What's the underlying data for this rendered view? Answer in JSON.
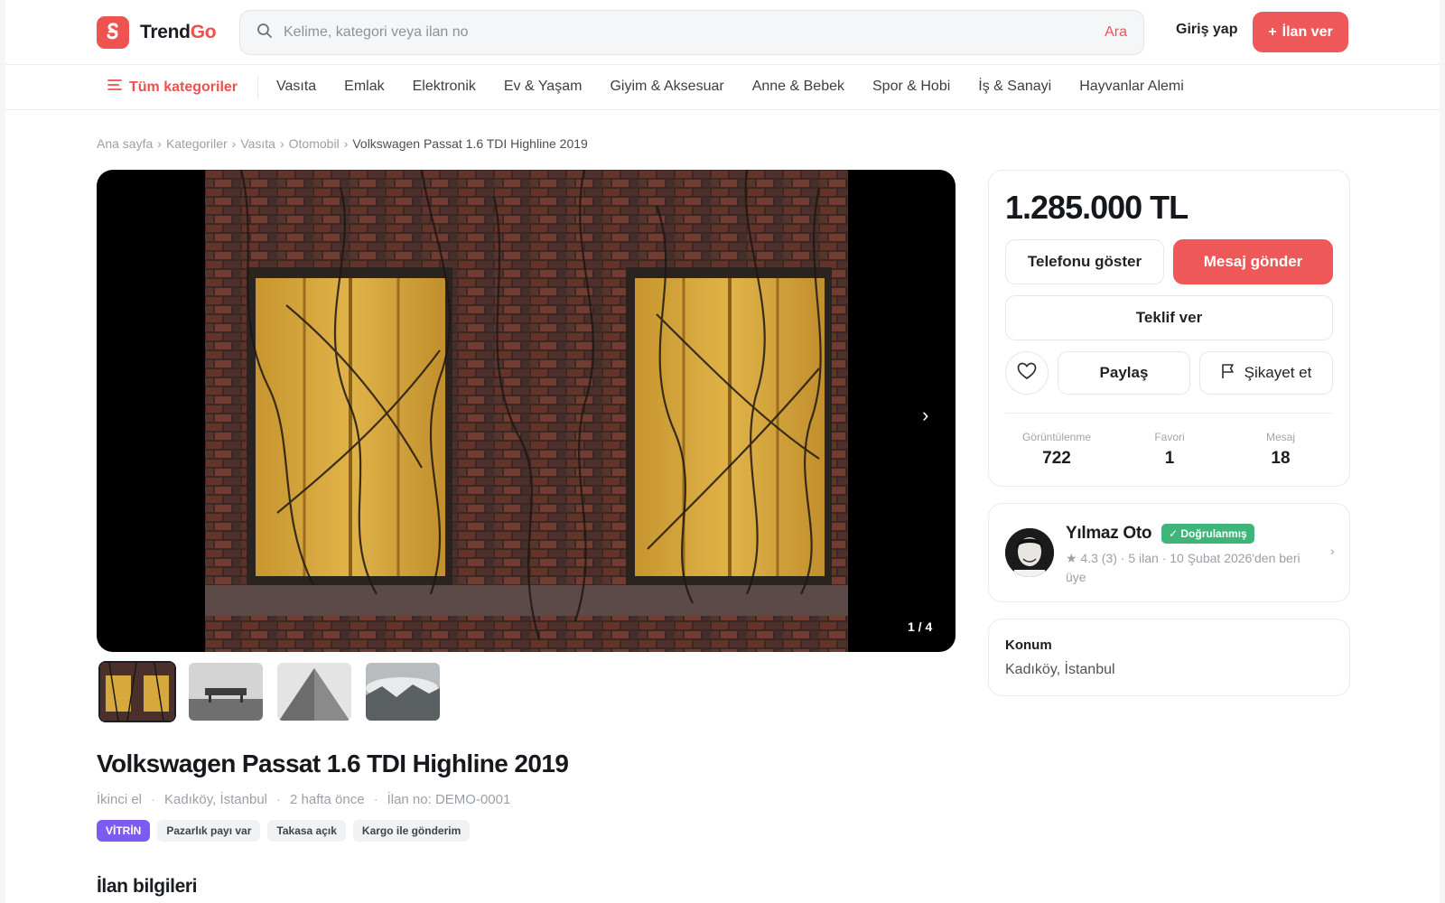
{
  "header": {
    "logo_brand": "Trend",
    "logo_accent": "Go",
    "search_placeholder": "Kelime, kategori veya ilan no",
    "search_button": "Ara",
    "login": "Giriş yap",
    "post_ad": "İlan ver",
    "post_ad_icon": "+"
  },
  "catnav": {
    "all_label": "Tüm kategoriler",
    "items": [
      "Vasıta",
      "Emlak",
      "Elektronik",
      "Ev & Yaşam",
      "Giyim & Aksesuar",
      "Anne & Bebek",
      "Spor & Hobi",
      "İş & Sanayi",
      "Hayvanlar Alemi"
    ]
  },
  "breadcrumb": {
    "items": [
      "Ana sayfa",
      "Kategoriler",
      "Vasıta",
      "Otomobil"
    ],
    "separator": "›",
    "current": "Volkswagen Passat 1.6 TDI Highline 2019"
  },
  "gallery": {
    "counter": "1 / 4",
    "next_icon": "›"
  },
  "listing": {
    "title": "Volkswagen Passat 1.6 TDI Highline 2019",
    "condition": "İkinci el",
    "location": "Kadıköy, İstanbul",
    "posted": "2 hafta önce",
    "listing_no": "İlan no: DEMO-0001",
    "meta_dot": "·",
    "tags": [
      "VİTRİN",
      "Pazarlık payı var",
      "Takasa açık",
      "Kargo ile gönderim"
    ],
    "section_heading": "İlan bilgileri"
  },
  "price_card": {
    "price": "1.285.000 TL",
    "show_phone": "Telefonu göster",
    "send_message": "Mesaj gönder",
    "make_offer": "Teklif ver",
    "share": "Paylaş",
    "report": "Şikayet et",
    "stats": [
      {
        "label": "Görüntülenme",
        "value": "722"
      },
      {
        "label": "Favori",
        "value": "1"
      },
      {
        "label": "Mesaj",
        "value": "18"
      }
    ]
  },
  "seller": {
    "name": "Yılmaz Oto",
    "badge": "✓ Doğrulanmış",
    "info": "★ 4.3 (3) · 5 ilan · 10 Şubat 2026'den beri üye",
    "chevron": "›"
  },
  "location_card": {
    "heading": "Konum",
    "value": "Kadıköy, İstanbul"
  },
  "colors": {
    "accent": "#ef5858",
    "verified": "#3fb57a",
    "vitrin": "#7c5cf0"
  }
}
